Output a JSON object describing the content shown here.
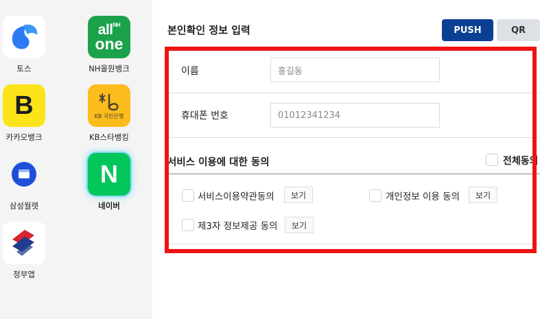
{
  "sidebar": {
    "apps": [
      {
        "name": "토스",
        "icon": "toss-icon",
        "color": "#2d7bf4"
      },
      {
        "name": "NH올원뱅크",
        "icon": "nh-allone-icon",
        "color": "#1ca24b",
        "logo_text": [
          "all",
          "NH",
          "one"
        ]
      },
      {
        "name": "카카오뱅크",
        "icon": "kakaobank-icon",
        "color": "#fde31a",
        "logo_text": "B"
      },
      {
        "name": "KB스타뱅킹",
        "icon": "kb-starbanking-icon",
        "color": "#fbbc1c",
        "logo_text": [
          "KB 국민은행"
        ]
      },
      {
        "name": "삼성월렛",
        "icon": "samsung-wallet-icon",
        "color": "#1d4fd8"
      },
      {
        "name": "네이버",
        "icon": "naver-icon",
        "color": "#03c75a",
        "logo_text": "N",
        "selected": true
      },
      {
        "name": "정부앱",
        "icon": "gov-app-icon",
        "color": "#d6262f"
      }
    ]
  },
  "main": {
    "title": "본인확인 정보 입력",
    "push_label": "PUSH",
    "qr_label": "QR",
    "form": {
      "name_label": "이름",
      "name_placeholder": "홍길동",
      "phone_label": "휴대폰 번호",
      "phone_placeholder": "01012341234"
    },
    "consent": {
      "section_title": "서비스 이용에 대한 동의",
      "all_label": "전체동의",
      "items": [
        {
          "label": "서비스이용약관동의",
          "view": "보기"
        },
        {
          "label": "개인정보 이용 동의",
          "view": "보기"
        },
        {
          "label": "제3자 정보제공 동의",
          "view": "보기"
        }
      ]
    },
    "highlight_color": "#ef1313",
    "push_color": "#0b3f93"
  }
}
